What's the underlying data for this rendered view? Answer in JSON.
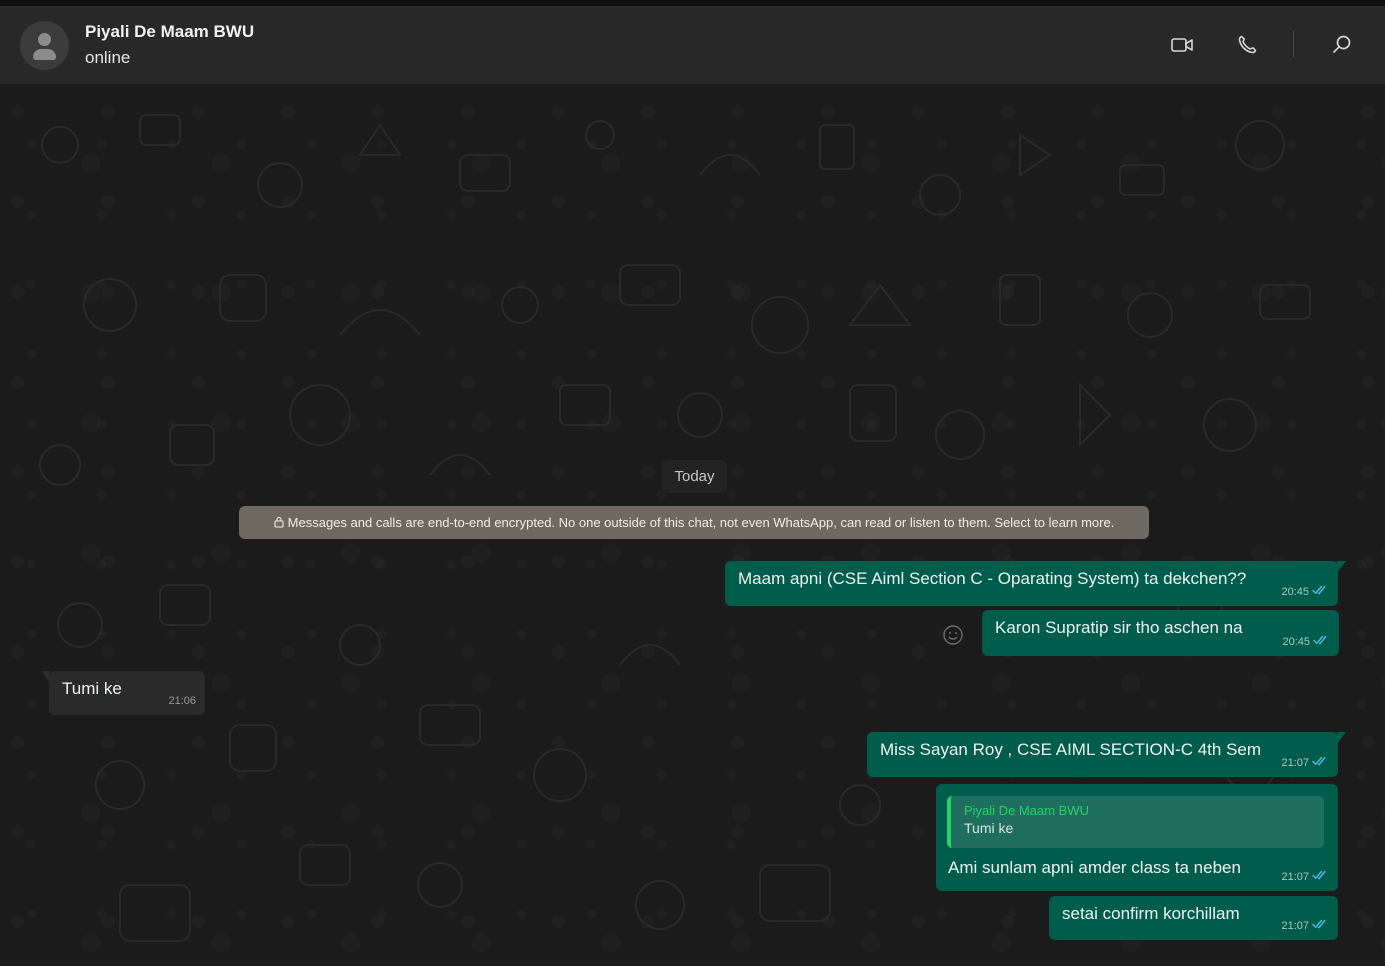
{
  "header": {
    "contact_name": "Piyali De Maam BWU",
    "status": "online",
    "icons": {
      "video": "video-call-icon",
      "voice": "voice-call-icon",
      "search": "search-icon"
    }
  },
  "chat": {
    "date_separator": "Today",
    "encryption_notice": "Messages and calls are end-to-end encrypted. No one outside of this chat, not even WhatsApp, can read or listen to them. Select to learn more.",
    "messages": [
      {
        "direction": "out",
        "text": "Maam apni (CSE Aiml Section C - Oparating System) ta dekchen??",
        "time": "20:45",
        "status": "read"
      },
      {
        "direction": "out",
        "text": "Karon Supratip sir tho aschen na",
        "time": "20:45",
        "status": "read"
      },
      {
        "direction": "in",
        "text": "Tumi ke",
        "time": "21:06"
      },
      {
        "direction": "out",
        "text": "Miss Sayan Roy , CSE AIML SECTION-C 4th Sem",
        "time": "21:07",
        "status": "read"
      },
      {
        "direction": "out",
        "reply_to": {
          "author": "Piyali De Maam BWU",
          "text": "Tumi ke"
        },
        "text": "Ami sunlam apni amder class ta neben",
        "time": "21:07",
        "status": "read"
      },
      {
        "direction": "out",
        "text": "setai confirm korchillam",
        "time": "21:07",
        "status": "read"
      }
    ]
  },
  "colors": {
    "header_bg": "#292929",
    "chat_bg": "#1b1b1b",
    "outgoing_bubble": "#005c4b",
    "incoming_bubble": "#2b2b2b",
    "read_tick": "#53bdeb",
    "quote_accent": "#25d366",
    "encryption_banner": "#6e6a62"
  }
}
